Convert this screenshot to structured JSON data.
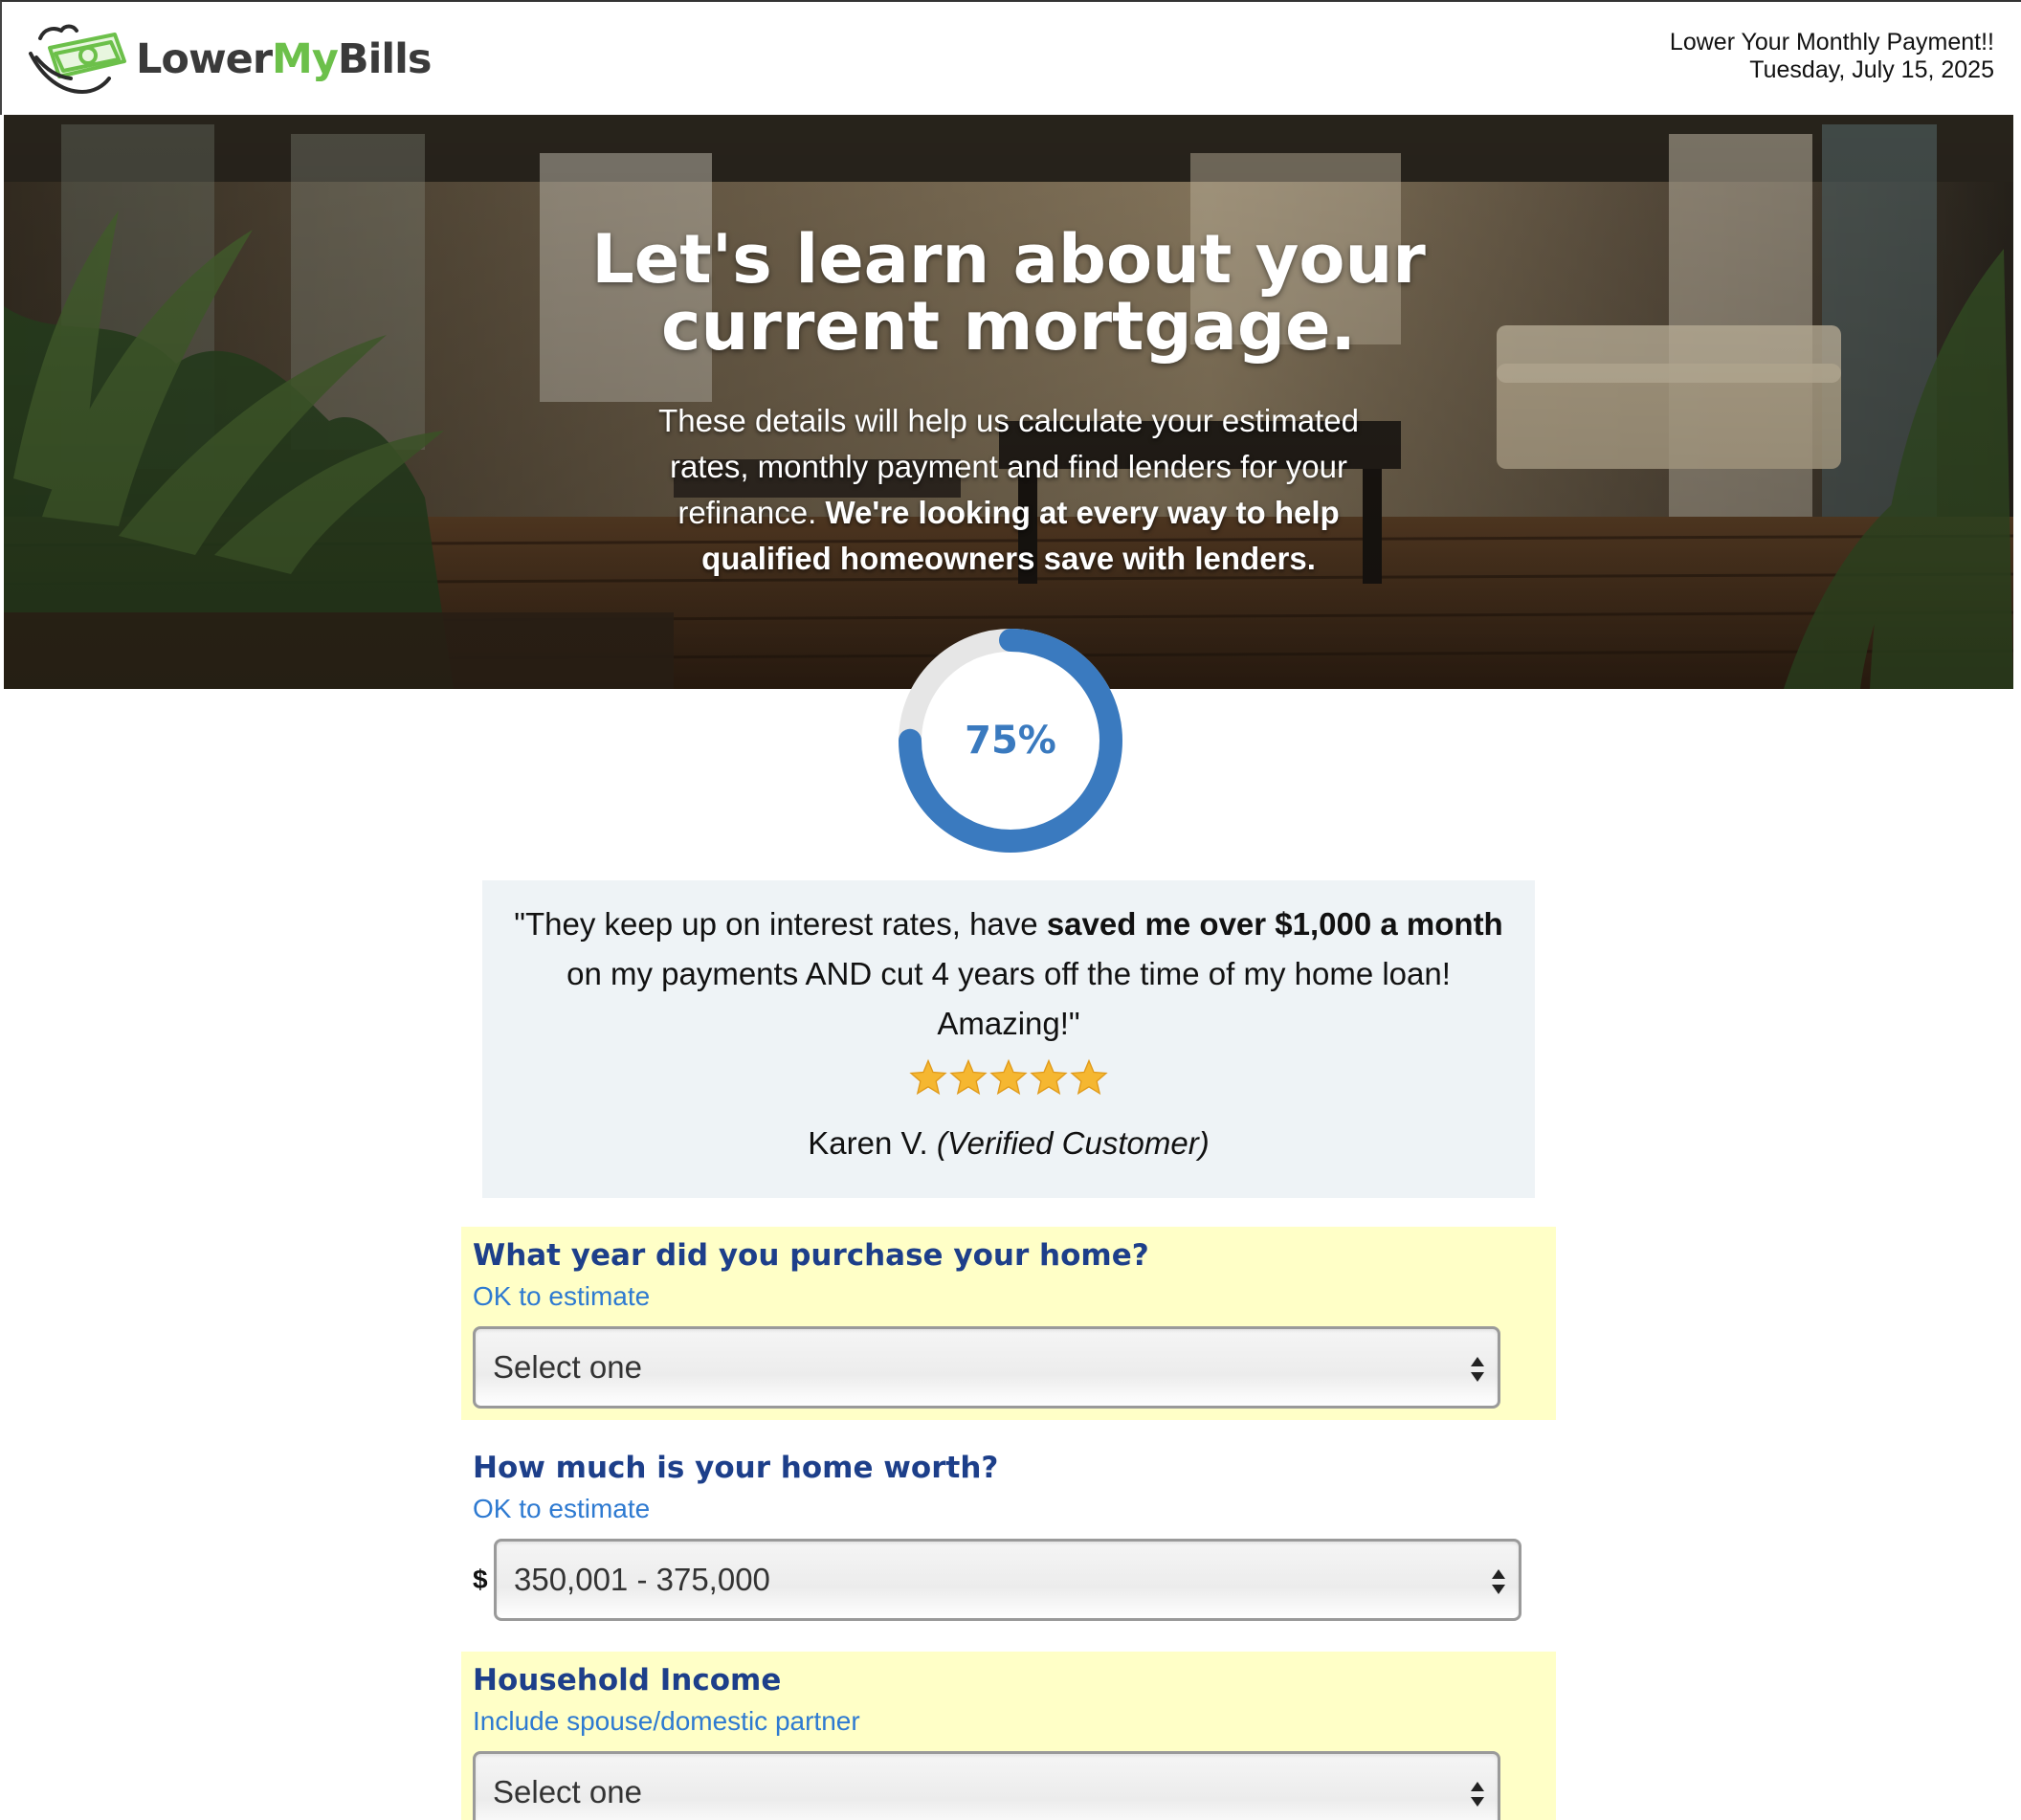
{
  "header": {
    "logo_part1": "Lower",
    "logo_part2": "My",
    "logo_part3": "Bills",
    "tagline": "Lower Your Monthly Payment!!",
    "date": "Tuesday, July 15, 2025"
  },
  "hero": {
    "title_line1": "Let's learn about your",
    "title_line2": "current mortgage.",
    "subtitle_plain": "These details will help us calculate your estimated rates, monthly payment and find lenders for your refinance.",
    "subtitle_bold": "We're looking at every way to help qualified homeowners save with lenders."
  },
  "progress": {
    "value": 0.75,
    "label": "75%",
    "color": "#3a7abf"
  },
  "testimonial": {
    "quote_open": "\"They keep up on interest rates, have",
    "quote_bold": "saved me over $1,000 a month",
    "quote_close": "on my payments AND cut 4 years off the time of my home loan! Amazing!\"",
    "rating": 5,
    "reviewer_name": "Karen V.",
    "reviewer_tag": "(Verified Customer)"
  },
  "form": {
    "purchase_year": {
      "label": "What year did you purchase your home?",
      "hint": "OK to estimate",
      "value": "Select one"
    },
    "home_worth": {
      "label": "How much is your home worth?",
      "hint": "OK to estimate",
      "currency": "$",
      "value": "350,001 - 375,000"
    },
    "household_income": {
      "label": "Household Income",
      "hint": "Include spouse/domestic partner",
      "value": "Select one"
    }
  },
  "colors": {
    "brand_green": "#6cc04a",
    "question_blue": "#1d3f8a",
    "hint_blue": "#2e7ad1",
    "highlight_yellow": "#ffffc7",
    "star_gold": "#f5b731"
  }
}
